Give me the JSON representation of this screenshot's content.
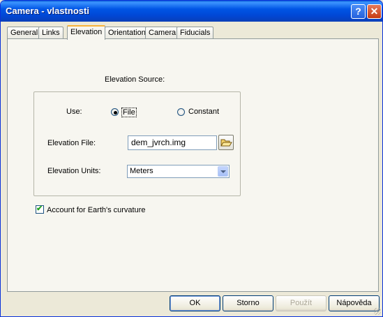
{
  "window": {
    "title": "Camera - vlastnosti",
    "help_glyph": "?",
    "close_glyph": "✕"
  },
  "tabs": [
    {
      "label": "General",
      "active": false
    },
    {
      "label": "Links",
      "active": false
    },
    {
      "label": "Elevation",
      "active": true
    },
    {
      "label": "Orientation",
      "active": false
    },
    {
      "label": "Camera",
      "active": false
    },
    {
      "label": "Fiducials",
      "active": false
    }
  ],
  "elevation": {
    "section_title": "Elevation Source:",
    "use_label": "Use:",
    "source_options": [
      {
        "label": "File",
        "selected": true
      },
      {
        "label": "Constant",
        "selected": false
      }
    ],
    "file_label": "Elevation File:",
    "file_value": "dem_jvrch.img",
    "units_label": "Elevation Units:",
    "units_value": "Meters",
    "curvature_label": "Account for Earth's curvature",
    "curvature_checked": true
  },
  "buttons": {
    "ok": "OK",
    "cancel": "Storno",
    "apply": "Použít",
    "help": "Nápověda"
  },
  "icons": {
    "browse": "folder-open-icon",
    "dropdown": "chevron-down-icon"
  }
}
